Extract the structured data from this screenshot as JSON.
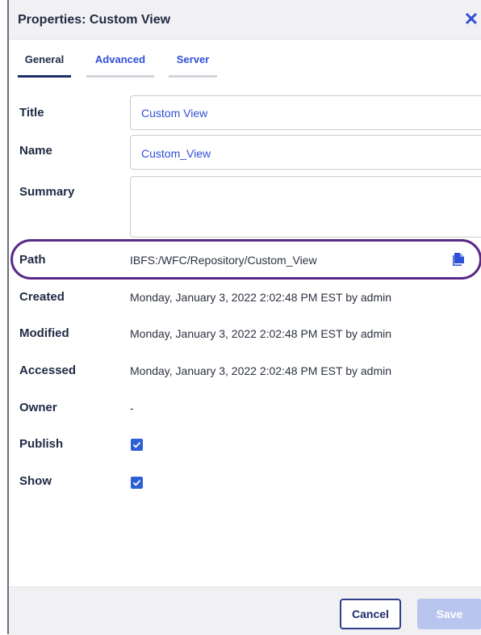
{
  "dialog": {
    "title": "Properties: Custom View",
    "close_icon": "close-icon"
  },
  "tabs": [
    {
      "label": "General",
      "active": true
    },
    {
      "label": "Advanced",
      "active": false
    },
    {
      "label": "Server",
      "active": false
    }
  ],
  "form": {
    "title_label": "Title",
    "title_value": "Custom View",
    "name_label": "Name",
    "name_value": "Custom_View",
    "summary_label": "Summary",
    "summary_value": "",
    "path_label": "Path",
    "path_value": "IBFS:/WFC/Repository/Custom_View",
    "copy_icon": "copy-icon",
    "created_label": "Created",
    "created_value": "Monday, January 3, 2022 2:02:48 PM EST by admin",
    "modified_label": "Modified",
    "modified_value": "Monday, January 3, 2022 2:02:48 PM EST by admin",
    "accessed_label": "Accessed",
    "accessed_value": "Monday, January 3, 2022 2:02:48 PM EST by admin",
    "owner_label": "Owner",
    "owner_value": "-",
    "publish_label": "Publish",
    "publish_checked": true,
    "show_label": "Show",
    "show_checked": true
  },
  "footer": {
    "cancel_label": "Cancel",
    "save_label": "Save"
  },
  "colors": {
    "accent": "#2f4fd6",
    "highlight_outline": "#5a2a86",
    "save_disabled": "#b8c5ef"
  }
}
